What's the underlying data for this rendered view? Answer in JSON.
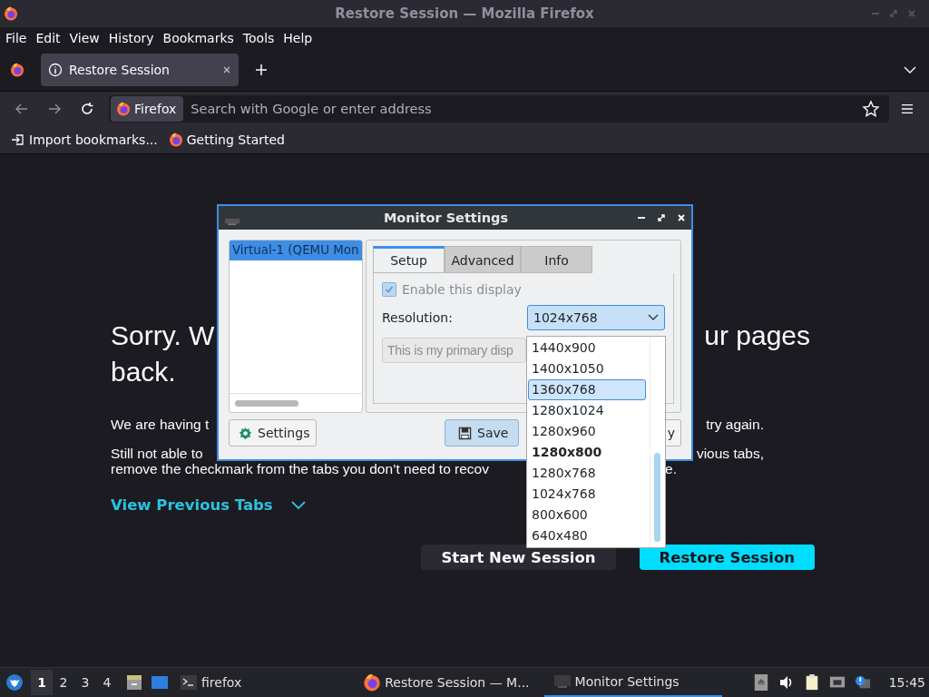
{
  "window": {
    "title": "Restore Session — Mozilla Firefox"
  },
  "menu": [
    "File",
    "Edit",
    "View",
    "History",
    "Bookmarks",
    "Tools",
    "Help"
  ],
  "tabs": [
    {
      "label": "Restore Session",
      "selected": true
    }
  ],
  "toolbar": {
    "identity": "Firefox",
    "placeholder": "Search with Google or enter address"
  },
  "bookmarks": [
    {
      "kind": "import",
      "label": "Import bookmarks..."
    },
    {
      "kind": "site",
      "label": "Getting Started"
    }
  ],
  "page": {
    "lines": [
      {
        "kind": "heading",
        "parts": [
          "Sorry. W",
          "ur pages"
        ]
      },
      {
        "kind": "heading",
        "parts": [
          "back."
        ]
      },
      {
        "kind": "text",
        "parts": [
          "We are having t",
          "try again."
        ]
      },
      {
        "kind": "text",
        "parts": [
          "Still not able to",
          "vious tabs,"
        ]
      },
      {
        "kind": "text",
        "parts": [
          "remove the checkmark from the tabs you don’t need to recov",
          "e."
        ]
      }
    ],
    "link": "View Previous Tabs",
    "buttons": [
      {
        "label": "Start New Session",
        "primary": false
      },
      {
        "label": "Restore Session",
        "primary": true
      }
    ]
  },
  "dialog": {
    "title": "Monitor Settings",
    "outputs": [
      {
        "label": "Virtual-1 (QEMU Mon",
        "selected": true
      }
    ],
    "tabs": [
      {
        "label": "Setup",
        "selected": true
      },
      {
        "label": "Advanced",
        "selected": false
      },
      {
        "label": "Info",
        "selected": false
      }
    ],
    "enable": {
      "label": "Enable this display",
      "checked": true,
      "disabled": true
    },
    "resolution": {
      "label": "Resolution:",
      "value": "1024x768"
    },
    "primary": {
      "label": "This is my primary disp",
      "disabled": true
    },
    "buttons": [
      {
        "kind": "settings",
        "label": "Settings",
        "default": false
      },
      {
        "kind": "save",
        "label": "Save",
        "default": true
      },
      {
        "kind": "apply",
        "label": "y",
        "default": false
      }
    ],
    "options": [
      {
        "label": "1440x900",
        "selected": false,
        "bold": false
      },
      {
        "label": "1400x1050",
        "selected": false,
        "bold": false
      },
      {
        "label": "1360x768",
        "selected": true,
        "bold": false
      },
      {
        "label": "1280x1024",
        "selected": false,
        "bold": false
      },
      {
        "label": "1280x960",
        "selected": false,
        "bold": false
      },
      {
        "label": "1280x800",
        "selected": false,
        "bold": true
      },
      {
        "label": "1280x768",
        "selected": false,
        "bold": false
      },
      {
        "label": "1024x768",
        "selected": false,
        "bold": false
      },
      {
        "label": "800x600",
        "selected": false,
        "bold": false
      },
      {
        "label": "640x480",
        "selected": false,
        "bold": false
      }
    ]
  },
  "taskbar": {
    "workspaces": [
      {
        "label": "1",
        "selected": true
      },
      {
        "label": "2",
        "selected": false
      },
      {
        "label": "3",
        "selected": false
      },
      {
        "label": "4",
        "selected": false
      }
    ],
    "quick": {
      "label": "firefox"
    },
    "tasks": [
      {
        "kind": "browser",
        "label": "Restore Session — M...",
        "active": false
      },
      {
        "kind": "window",
        "label": "Monitor Settings",
        "active": true
      }
    ],
    "clock": "15:45"
  }
}
